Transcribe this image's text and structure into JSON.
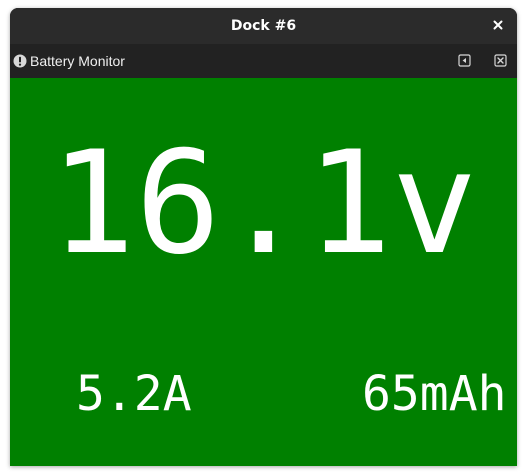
{
  "window": {
    "title": "Dock #6"
  },
  "dock": {
    "label": "Battery Monitor",
    "status_icon": "alert-circle-icon",
    "float_icon": "undock-icon",
    "close_icon": "close-icon"
  },
  "readings": {
    "voltage": "16.1v",
    "current": "5.2A",
    "capacity": "65mAh"
  },
  "colors": {
    "panel_background": "#008000",
    "reading_text": "#ffffff",
    "titlebar": "#2b2b2b",
    "dockbar": "#222222"
  }
}
